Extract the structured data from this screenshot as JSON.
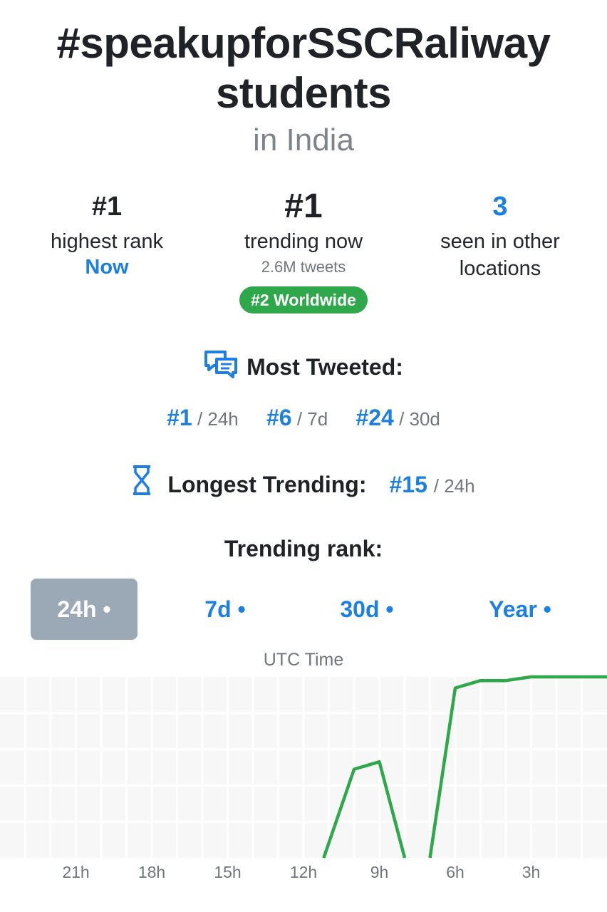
{
  "header": {
    "title_line1": "#speakupforSSCRaliway",
    "title_line2": "students",
    "location": "in India"
  },
  "stats": {
    "highest": {
      "value": "#1",
      "label": "highest rank",
      "when": "Now"
    },
    "trending": {
      "value": "#1",
      "label": "trending now",
      "tweets": "2.6M tweets",
      "worldwide": "#2 Worldwide"
    },
    "other": {
      "value": "3",
      "label_line1": "seen in other",
      "label_line2": "locations"
    }
  },
  "most_tweeted": {
    "heading": "Most Tweeted:",
    "ranks": [
      {
        "rank": "#1",
        "period": "/ 24h"
      },
      {
        "rank": "#6",
        "period": "/ 7d"
      },
      {
        "rank": "#24",
        "period": "/ 30d"
      }
    ]
  },
  "longest_trending": {
    "heading": "Longest Trending:",
    "rank": "#15",
    "period": "/ 24h"
  },
  "trending_rank": {
    "heading": "Trending rank:",
    "tabs": [
      "24h •",
      "7d •",
      "30d •",
      "Year •"
    ],
    "active_tab": 0
  },
  "colors": {
    "accent": "#1d7fe0",
    "line": "#2ea84a",
    "badge": "#2ea84a",
    "tab_active": "#9ba8b5"
  },
  "icons": {
    "most_tweeted": "chat-bubbles-icon",
    "longest_trending": "hourglass-icon"
  },
  "chart_data": {
    "type": "line",
    "xlabel": "UTC Time",
    "x_ticks": [
      "21h",
      "18h",
      "15h",
      "12h",
      "9h",
      "6h",
      "3h"
    ],
    "x_tick_hours_ago": [
      21,
      18,
      15,
      12,
      9,
      6,
      3
    ],
    "xlim_hours_ago": [
      24,
      0
    ],
    "y_inverted_rank": true,
    "ylim_rank": [
      1,
      50
    ],
    "grid": true,
    "series": [
      {
        "values": [
          {
            "hours_ago": 11.2,
            "rank": 50
          },
          {
            "hours_ago": 10.0,
            "rank": 26
          },
          {
            "hours_ago": 9.0,
            "rank": 24
          },
          {
            "hours_ago": 8.0,
            "rank": 50
          }
        ]
      },
      {
        "values": [
          {
            "hours_ago": 7.0,
            "rank": 50
          },
          {
            "hours_ago": 6.0,
            "rank": 4
          },
          {
            "hours_ago": 5.0,
            "rank": 2
          },
          {
            "hours_ago": 4.0,
            "rank": 2
          },
          {
            "hours_ago": 3.0,
            "rank": 1
          },
          {
            "hours_ago": 0.0,
            "rank": 1
          }
        ]
      }
    ]
  }
}
